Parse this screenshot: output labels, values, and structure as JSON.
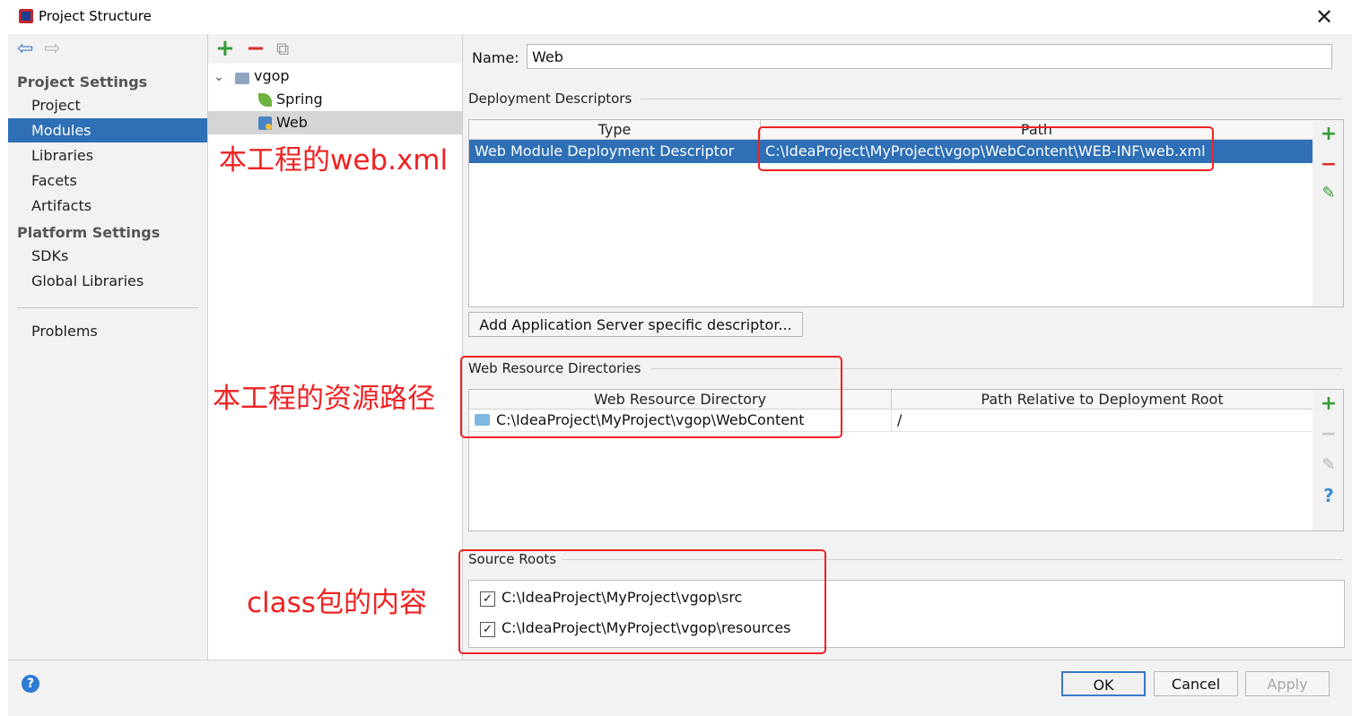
{
  "window": {
    "title": "Project Structure",
    "close_glyph": "✕"
  },
  "nav": {
    "back_glyph": "⇦",
    "forward_glyph": "⇨"
  },
  "sidebar": {
    "project_settings_header": "Project Settings",
    "items": [
      "Project",
      "Modules",
      "Libraries",
      "Facets",
      "Artifacts"
    ],
    "selected": "Modules",
    "platform_settings_header": "Platform Settings",
    "platform_items": [
      "SDKs",
      "Global Libraries"
    ],
    "problems": "Problems"
  },
  "tree": {
    "toolbar": {
      "add": "+",
      "remove": "−",
      "copy": "⧉"
    },
    "root": "vgop",
    "children": [
      "Spring",
      "Web"
    ],
    "selected": "Web"
  },
  "annotations": {
    "web_xml": "本工程的web.xml",
    "resource_path": "本工程的资源路径",
    "class_content": "class包的内容"
  },
  "main": {
    "name_label": "Name:",
    "name_value": "Web",
    "deployment": {
      "title": "Deployment Descriptors",
      "columns": [
        "Type",
        "Path"
      ],
      "rows": [
        {
          "type": "Web Module Deployment Descriptor",
          "path": "C:\\IdeaProject\\MyProject\\vgop\\WebContent\\WEB-INF\\web.xml"
        }
      ],
      "add_server_button": "Add Application Server specific descriptor..."
    },
    "web_resources": {
      "title": "Web Resource Directories",
      "columns": [
        "Web Resource Directory",
        "Path Relative to Deployment Root"
      ],
      "rows": [
        {
          "directory": "C:\\IdeaProject\\MyProject\\vgop\\WebContent",
          "relative": "/"
        }
      ]
    },
    "source_roots": {
      "title": "Source Roots",
      "items": [
        {
          "path": "C:\\IdeaProject\\MyProject\\vgop\\src",
          "checked": true
        },
        {
          "path": "C:\\IdeaProject\\MyProject\\vgop\\resources",
          "checked": true
        }
      ]
    }
  },
  "side_tools": {
    "add": "+",
    "remove": "−",
    "edit": "✎",
    "help": "?"
  },
  "footer": {
    "help": "?",
    "ok": "OK",
    "cancel": "Cancel",
    "apply": "Apply"
  },
  "colors": {
    "selection": "#2e6fb6",
    "annotation_red": "#ee2222",
    "add_green": "#3a9a3a",
    "remove_red": "#d9302a"
  }
}
